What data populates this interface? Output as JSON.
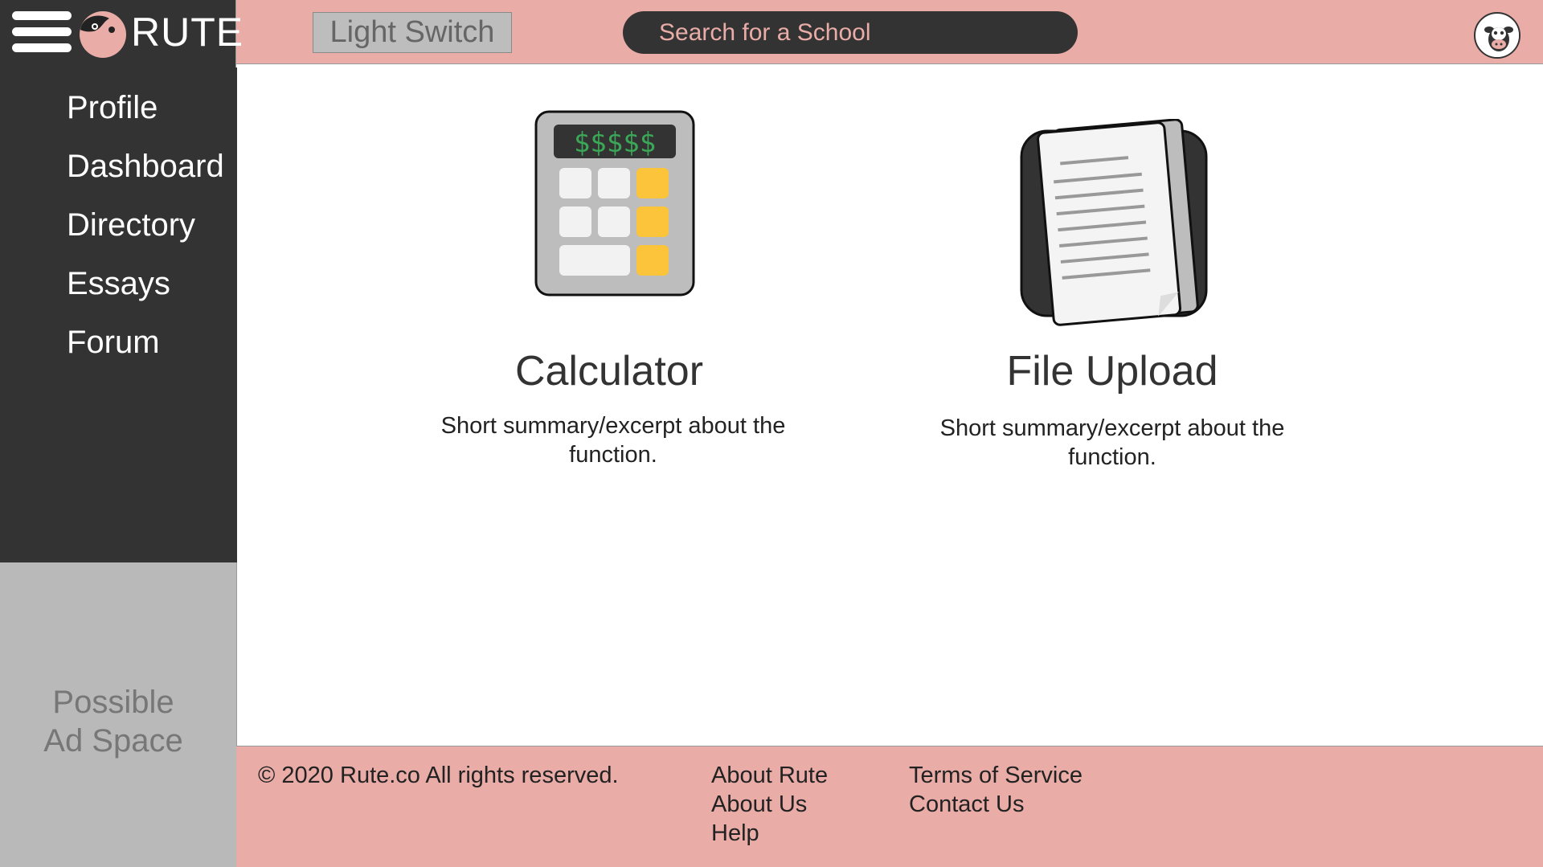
{
  "header": {
    "brand_name": "RUTE",
    "light_switch_label": "Light Switch",
    "search_placeholder": "Search for a School"
  },
  "sidebar": {
    "items": [
      {
        "label": "Profile"
      },
      {
        "label": "Dashboard"
      },
      {
        "label": "Directory"
      },
      {
        "label": "Essays"
      },
      {
        "label": "Forum"
      }
    ],
    "ad_text": "Possible\nAd Space"
  },
  "main": {
    "cards": [
      {
        "title": "Calculator",
        "summary": "Short summary/excerpt about the function.",
        "icon": "calculator-icon",
        "display_text": "$$$$$"
      },
      {
        "title": "File Upload",
        "summary": "Short summary/excerpt about the function.",
        "icon": "document-icon"
      }
    ]
  },
  "footer": {
    "copyright": "© 2020 Rute.co All rights reserved.",
    "links_col1": [
      "About Rute",
      "About Us",
      "Help"
    ],
    "links_col2": [
      "Terms of Service",
      "Contact Us"
    ]
  },
  "colors": {
    "header_bg": "#e9aca7",
    "sidebar_bg": "#333333",
    "ad_bg": "#b9b9b9",
    "accent_yellow": "#fbc43a",
    "display_green": "#3aa857"
  }
}
